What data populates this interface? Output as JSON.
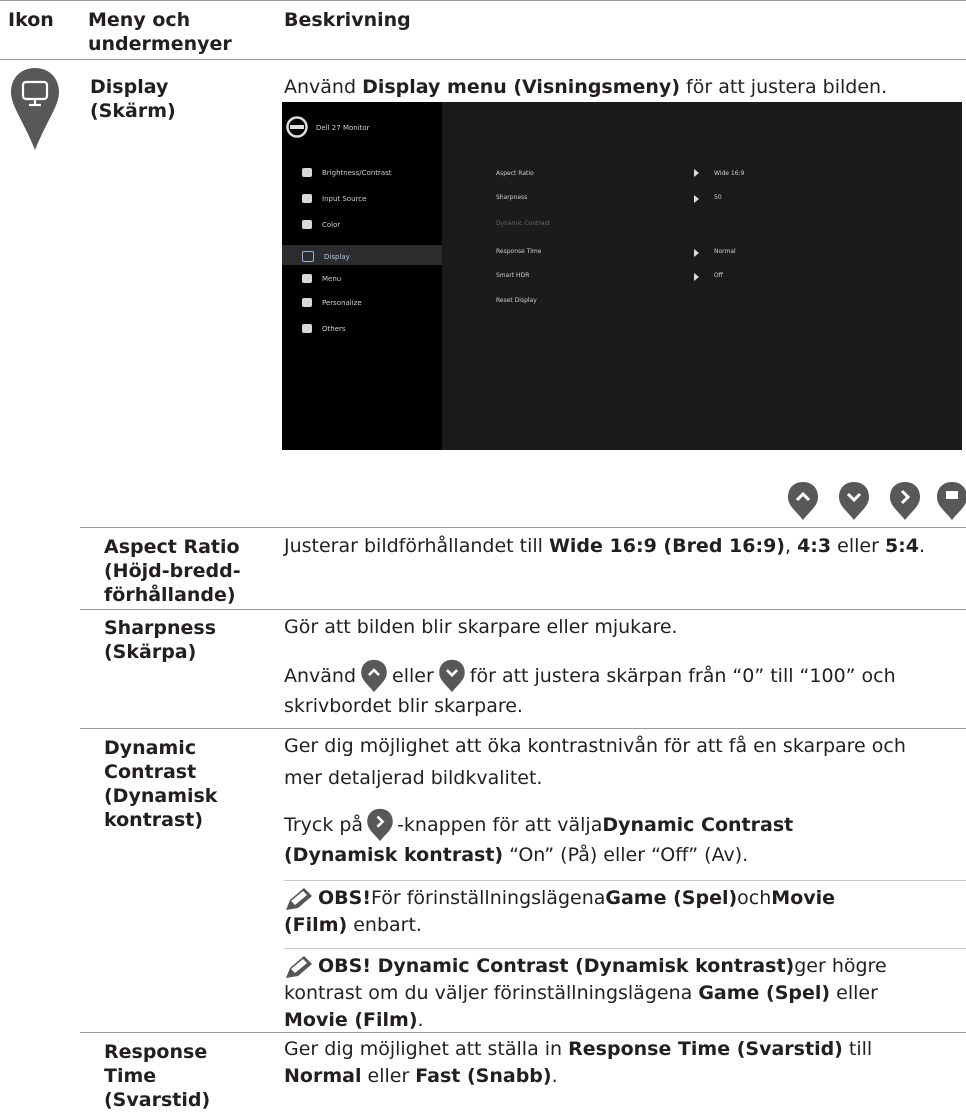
{
  "header": {
    "col_icon": "Ikon",
    "col_menu_line1": "Meny och",
    "col_menu_line2": "undermenyer",
    "col_desc": "Beskrivning"
  },
  "display": {
    "menu_line1": "Display",
    "menu_line2": "(Skärm)",
    "intro_pre": "Använd ",
    "intro_bold": "Display menu (Visningsmeny)",
    "intro_post": " för att justera bilden."
  },
  "osd": {
    "title": "Dell 27 Monitor",
    "menu_items": [
      "Brightness/Contrast",
      "Input Source",
      "Color",
      "Display",
      "Menu",
      "Personalize",
      "Others"
    ],
    "settings": [
      "Aspect Ratio",
      "Sharpness",
      "Dynamic Contrast",
      "Response Time",
      "Smart HDR",
      "Reset Display"
    ],
    "values": [
      "Wide 16:9",
      "50",
      "",
      "Normal",
      "Off",
      ""
    ]
  },
  "aspect": {
    "menu_line1": "Aspect Ratio",
    "menu_line2": "(Höjd-bredd-",
    "menu_line3": "förhållande)",
    "pre": "Justerar bildförhållandet till ",
    "b1": "Wide 16:9 (Bred 16:9)",
    "m1": ", ",
    "b2": "4:3",
    "m2": " eller ",
    "b3": "5:4",
    "post": "."
  },
  "sharpness": {
    "menu_line1": "Sharpness",
    "menu_line2": "(Skärpa)",
    "line1": "Gör att bilden blir skarpare eller mjukare.",
    "l2_pre": "Använd ",
    "l2_mid": " eller ",
    "l2_post": " för att justera skärpan från “0” till “100” och",
    "line3": "skrivbordet blir skarpare."
  },
  "dynamic": {
    "menu_line1": "Dynamic",
    "menu_line2": "Contrast",
    "menu_line3": "(Dynamisk",
    "menu_line4": "kontrast)",
    "p1_line1": "Ger dig möjlighet att öka kontrastnivån för att få en skarpare och",
    "p1_line2": "mer detaljerad bildkvalitet.",
    "p2_pre": "Tryck på ",
    "p2_post": "-knappen för att välja ",
    "p2_bold1": "Dynamic Contrast",
    "p2_bold2": "(Dynamisk kontrast)",
    "p2_tail": " “On” (På)  eller “Off” (Av).",
    "note1_bold": "OBS!",
    "note1_text": " För förinställningslägena ",
    "note1_b2": "Game (Spel)",
    "note1_m": " och ",
    "note1_b3": "Movie",
    "note1_l2_b": "(Film)",
    "note1_l2_t": " enbart.",
    "note2_bold": "OBS! Dynamic Contrast (Dynamisk kontrast)",
    "note2_t": " ger högre",
    "note2_l2_pre": "kontrast om du väljer förinställningslägena ",
    "note2_l2_b": "Game (Spel)",
    "note2_l2_post": " eller",
    "note2_l3_b": "Movie (Film)",
    "note2_l3_post": "."
  },
  "response": {
    "menu_line1": "Response",
    "menu_line2": "Time",
    "menu_line3": "(Svarstid)",
    "l1_pre": "Ger dig möjlighet att ställa in ",
    "l1_b": "Response Time (Svarstid)",
    "l1_post": " till",
    "l2_b1": "Normal",
    "l2_m": " eller ",
    "l2_b2": "Fast (Snabb)",
    "l2_post": "."
  }
}
